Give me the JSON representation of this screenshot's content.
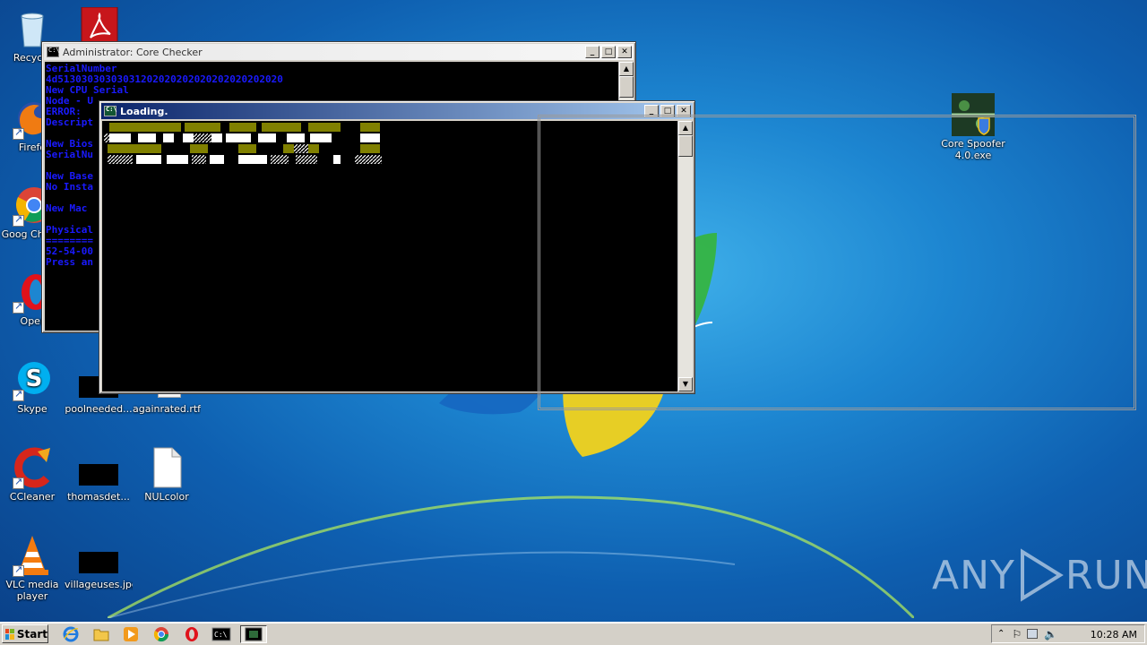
{
  "desktop": {
    "icons": [
      {
        "label": "Recycle"
      },
      {
        "label": "Firefo"
      },
      {
        "label": "Goog Chrom"
      },
      {
        "label": "Oper"
      },
      {
        "label": "Skype"
      },
      {
        "label": "poolneeded..."
      },
      {
        "label": "againrated.rtf"
      },
      {
        "label": "CCleaner"
      },
      {
        "label": "thomasdet..."
      },
      {
        "label": "NULcolor"
      },
      {
        "label": "VLC media player"
      },
      {
        "label": "villageuses.jpg"
      },
      {
        "label": "Core Spoofer 4.0.exe"
      }
    ]
  },
  "checker_window": {
    "title": "Administrator:  Core Checker",
    "lines": [
      "SerialNumber",
      "4d51303030303031202020202020202020202020",
      "",
      "New CPU Serial",
      "Node - U",
      "ERROR:",
      "Descript",
      "",
      "New Bios",
      "SerialNu",
      "",
      "New Base",
      "No Insta",
      "",
      "New Mac",
      "",
      "Physical",
      "========",
      "52-54-00",
      "Press an"
    ]
  },
  "loading_window": {
    "title": "Loading."
  },
  "taskbar": {
    "start_label": "Start",
    "clock": "10:28 AM"
  },
  "watermark": {
    "left": "ANY",
    "right": "RUN"
  }
}
